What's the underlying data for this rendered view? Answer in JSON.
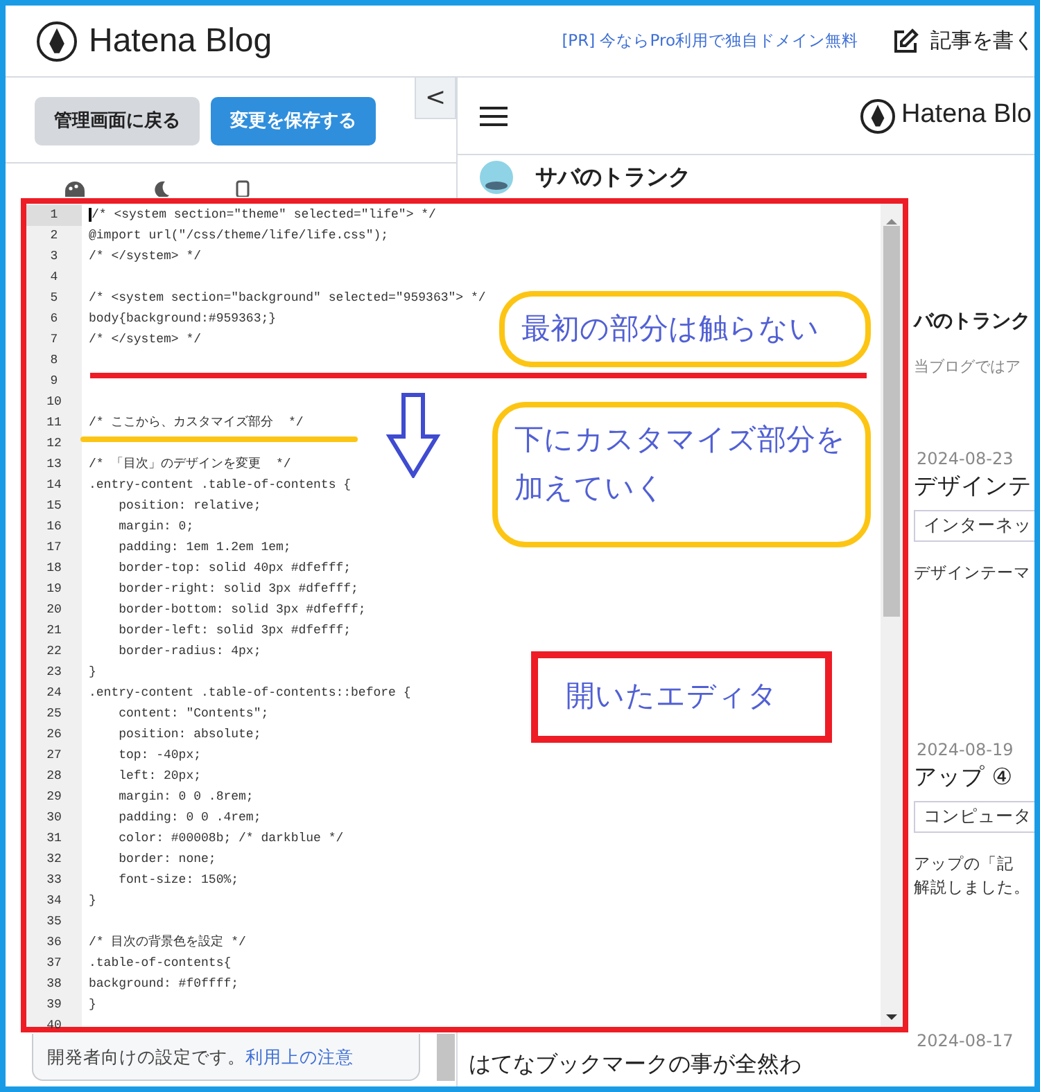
{
  "header": {
    "logo": "Hatena Blog",
    "promo_link": "[PR] 今ならPro利用で独自ドメイン無料",
    "write_link": "記事を書く"
  },
  "left_pane": {
    "buttons": [
      {
        "label": "管理画面に戻る",
        "kind": "secondary"
      },
      {
        "label": "変更を保存する",
        "kind": "primary"
      }
    ],
    "collapse": "<",
    "note": "開発者向けの設定です。",
    "note_link": "利用上の注意"
  },
  "editor": {
    "lines": [
      {
        "number": "1",
        "code": "/* <system section=\"theme\" selected=\"life\"> */",
        "cursor": true
      },
      {
        "number": "2",
        "code": "@import url(\"/css/theme/life/life.css\");"
      },
      {
        "number": "3",
        "code": "/* </system> */"
      },
      {
        "number": "4"
      },
      {
        "number": "5",
        "code": "/* <system section=\"background\" selected=\"959363\"> */"
      },
      {
        "number": "6",
        "code": "body{background:#959363;}"
      },
      {
        "number": "7",
        "code": "/* </system> */"
      },
      {
        "number": "8"
      },
      {
        "number": "9"
      },
      {
        "number": "10"
      },
      {
        "number": "11",
        "code": "/* ここから、カスタマイズ部分  */"
      },
      {
        "number": "12"
      },
      {
        "number": "13",
        "code": "/* 「目次」のデザインを変更  */"
      },
      {
        "number": "14",
        "code": ".entry-content .table-of-contents {"
      },
      {
        "number": "15",
        "code": "    position: relative;"
      },
      {
        "number": "16",
        "code": "    margin: 0;"
      },
      {
        "number": "17",
        "code": "    padding: 1em 1.2em 1em;"
      },
      {
        "number": "18",
        "code": "    border-top: solid 40px #dfefff;"
      },
      {
        "number": "19",
        "code": "    border-right: solid 3px #dfefff;"
      },
      {
        "number": "20",
        "code": "    border-bottom: solid 3px #dfefff;"
      },
      {
        "number": "21",
        "code": "    border-left: solid 3px #dfefff;"
      },
      {
        "number": "22",
        "code": "    border-radius: 4px;"
      },
      {
        "number": "23",
        "code": "}"
      },
      {
        "number": "24",
        "code": ".entry-content .table-of-contents::before {"
      },
      {
        "number": "25",
        "code": "    content: \"Contents\";"
      },
      {
        "number": "26",
        "code": "    position: absolute;"
      },
      {
        "number": "27",
        "code": "    top: -40px;"
      },
      {
        "number": "28",
        "code": "    left: 20px;"
      },
      {
        "number": "29",
        "code": "    margin: 0 0 .8rem;"
      },
      {
        "number": "30",
        "code": "    padding: 0 0 .4rem;"
      },
      {
        "number": "31",
        "code": "    color: #00008b; /* darkblue */"
      },
      {
        "number": "32",
        "code": "    border: none;"
      },
      {
        "number": "33",
        "code": "    font-size: 150%;"
      },
      {
        "number": "34",
        "code": "}"
      },
      {
        "number": "35"
      },
      {
        "number": "36",
        "code": "/* 目次の背景色を設定 */"
      },
      {
        "number": "37",
        "code": ".table-of-contents{"
      },
      {
        "number": "38",
        "code": "background: #f0ffff;"
      },
      {
        "number": "39",
        "code": "}"
      },
      {
        "number": "40"
      }
    ]
  },
  "annotations": [
    {
      "kind": "oval",
      "lines": [
        "最初の部分は触らない"
      ]
    },
    {
      "kind": "redline"
    },
    {
      "kind": "arrow"
    },
    {
      "kind": "underline"
    },
    {
      "kind": "oval",
      "lines": [
        "下にカスタマイズ部分を",
        "加えていく"
      ]
    },
    {
      "kind": "box",
      "lines": [
        "開いたエディタ"
      ]
    }
  ],
  "preview": {
    "logo": "Hatena Blo",
    "blog_title": "サバのトランク",
    "title_fragment": "バのトランク",
    "lead_fragment": "当ブログではア",
    "posts": [
      {
        "kind": "clipped",
        "date": "2024-08-23",
        "title": "デザインテ",
        "tag": "インターネッ",
        "summary": [
          "デザインテーマ"
        ]
      },
      {
        "kind": "clipped",
        "date": "2024-08-19",
        "title": "アップ ④",
        "tag": "コンピュータ",
        "summary": [
          "アップの「記",
          "解説しました。"
        ]
      },
      {
        "kind": "full",
        "date": "2024-08-17",
        "title": "はてなブックマークの事が全然わ"
      }
    ]
  }
}
